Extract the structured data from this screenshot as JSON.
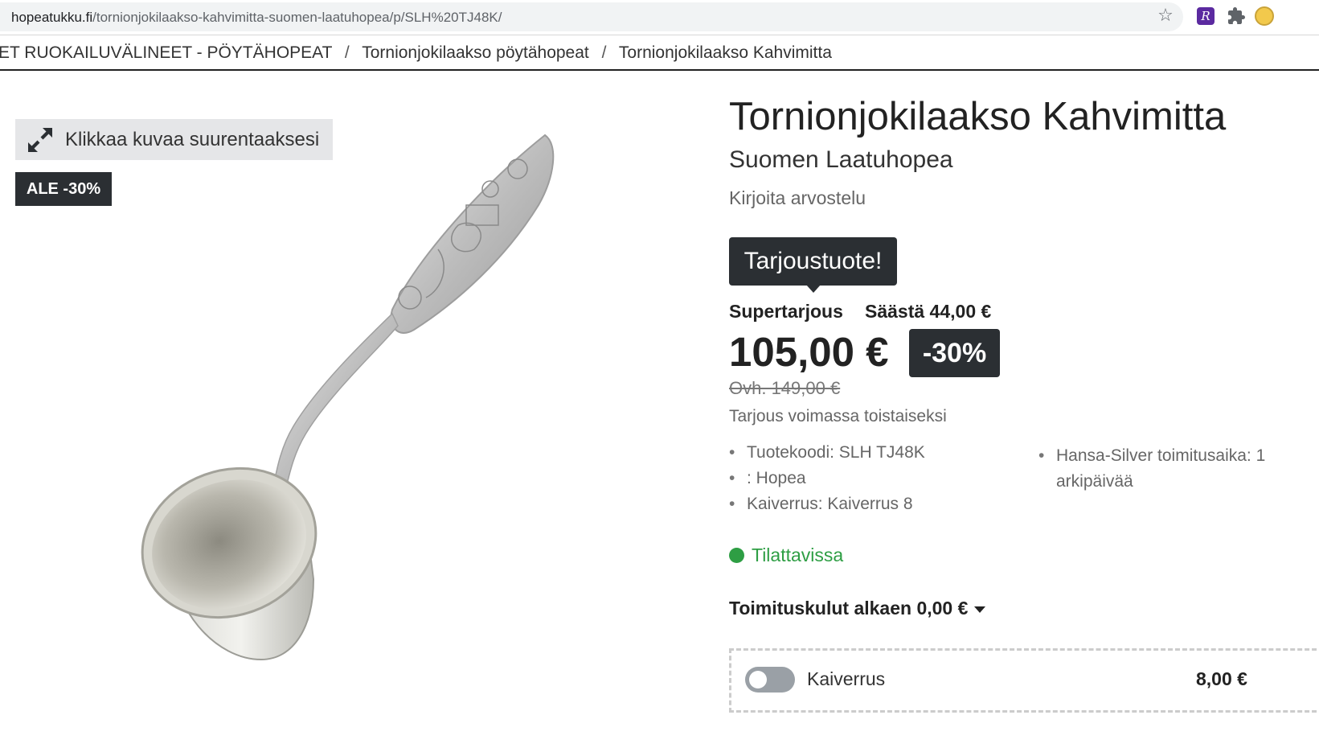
{
  "browser": {
    "url_host": "hopeatukku.fi",
    "url_path": "/tornionjokilaakso-kahvimitta-suomen-laatuhopea/p/SLH%20TJ48K/"
  },
  "breadcrumb": {
    "items": [
      "ET RUOKAILUVÄLINEET - PÖYTÄHOPEAT",
      "Tornionjokilaakso pöytähopeat",
      "Tornionjokilaakso Kahvimitta"
    ],
    "separator": "/"
  },
  "gallery": {
    "zoom_hint": "Klikkaa kuvaa suurentaaksesi",
    "sale_badge": "ALE -30%",
    "icon": "expand-icon"
  },
  "product": {
    "title": "Tornionjokilaakso Kahvimitta",
    "brand": "Suomen Laatuhopea",
    "review_link": "Kirjoita arvostelu",
    "offer_tag": "Tarjoustuote!",
    "super_offer": "Supertarjous",
    "savings": "Säästä 44,00 €",
    "price": "105,00 €",
    "discount": "-30%",
    "old_price": "Ovh. 149,00 €",
    "offer_valid": "Tarjous voimassa toistaiseksi",
    "specs": [
      "Tuotekoodi: SLH TJ48K",
      ": Hopea",
      "Kaiverrus: Kaiverrus 8 "
    ],
    "delivery": [
      "Hansa-Silver toimitusaika: 1",
      "arkipäivää"
    ],
    "stock": "Tilattavissa",
    "stock_color": "#2e9e44",
    "shipping": "Toimituskulut alkaen 0,00 €",
    "engraving": {
      "label": "Kaiverrus",
      "price": "8,00 €",
      "enabled": false
    }
  },
  "colors": {
    "dark_badge": "#2b2f33",
    "in_stock": "#2e9e44"
  }
}
